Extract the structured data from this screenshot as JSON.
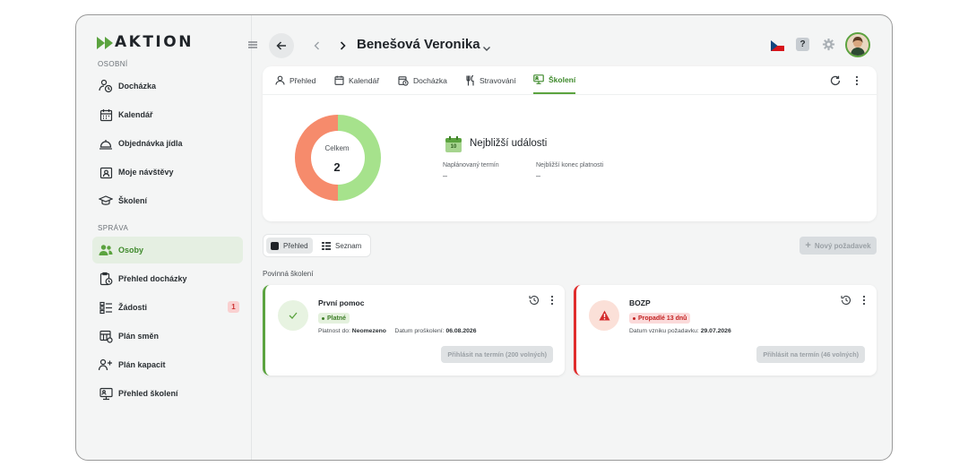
{
  "app": {
    "logo_text": "AKTION"
  },
  "sidebar": {
    "section_personal": "OSOBNÍ",
    "section_admin": "SPRÁVA",
    "items": [
      {
        "label": "Docházka",
        "icon": "clock-person-icon"
      },
      {
        "label": "Kalendář",
        "icon": "calendar-icon"
      },
      {
        "label": "Objednávka jídla",
        "icon": "food-order-icon"
      },
      {
        "label": "Moje návštěvy",
        "icon": "visits-icon"
      },
      {
        "label": "Školení",
        "icon": "graduation-cap-icon"
      },
      {
        "label": "Osoby",
        "icon": "people-icon",
        "active": true
      },
      {
        "label": "Přehled docházky",
        "icon": "attendance-overview-icon"
      },
      {
        "label": "Žádosti",
        "icon": "requests-icon",
        "badge": "1"
      },
      {
        "label": "Plán směn",
        "icon": "shift-plan-icon"
      },
      {
        "label": "Plán kapacit",
        "icon": "capacity-plan-icon"
      },
      {
        "label": "Přehled školení",
        "icon": "training-overview-icon"
      }
    ]
  },
  "header": {
    "person_name": "Benešová Veronika",
    "help_label": "?"
  },
  "tabs": [
    {
      "label": "Přehled",
      "icon": "person-icon"
    },
    {
      "label": "Kalendář",
      "icon": "calendar-icon"
    },
    {
      "label": "Docházka",
      "icon": "attendance-icon"
    },
    {
      "label": "Stravování",
      "icon": "fork-knife-icon"
    },
    {
      "label": "Školení",
      "icon": "training-icon",
      "active": true
    }
  ],
  "summary": {
    "donut_label": "Celkem",
    "donut_value": "2",
    "donut_segments": [
      {
        "status": "valid",
        "count": 1,
        "color": "#a6e28c"
      },
      {
        "status": "expired",
        "count": 1,
        "color": "#f68b6c"
      }
    ],
    "events_title": "Nejbližší události",
    "calendar_day": "10",
    "planned_label": "Naplánovaný termín",
    "planned_value": "–",
    "expiry_label": "Nejbližší konec platnosti",
    "expiry_value": "–"
  },
  "view_toggle": {
    "overview": "Přehled",
    "list": "Seznam"
  },
  "new_request_label": "Nový požadavek",
  "section_title": "Povinná školení",
  "trainings": [
    {
      "name": "První pomoc",
      "status": "Platné",
      "meta_label_1": "Platnost do:",
      "meta_value_1": "Neomezeno",
      "meta_label_2": "Datum proškolení:",
      "meta_value_2": "06.08.2026",
      "signup": "Přihlásit na termín (200 volných)"
    },
    {
      "name": "BOZP",
      "status": "Propadlé 13 dnů",
      "meta_label_1": "Datum vzniku požadavku:",
      "meta_value_1": "29.07.2026",
      "signup": "Přihlásit na termín (46 volných)"
    }
  ],
  "colors": {
    "accent": "#5ba33f",
    "danger": "#e02d2d"
  }
}
